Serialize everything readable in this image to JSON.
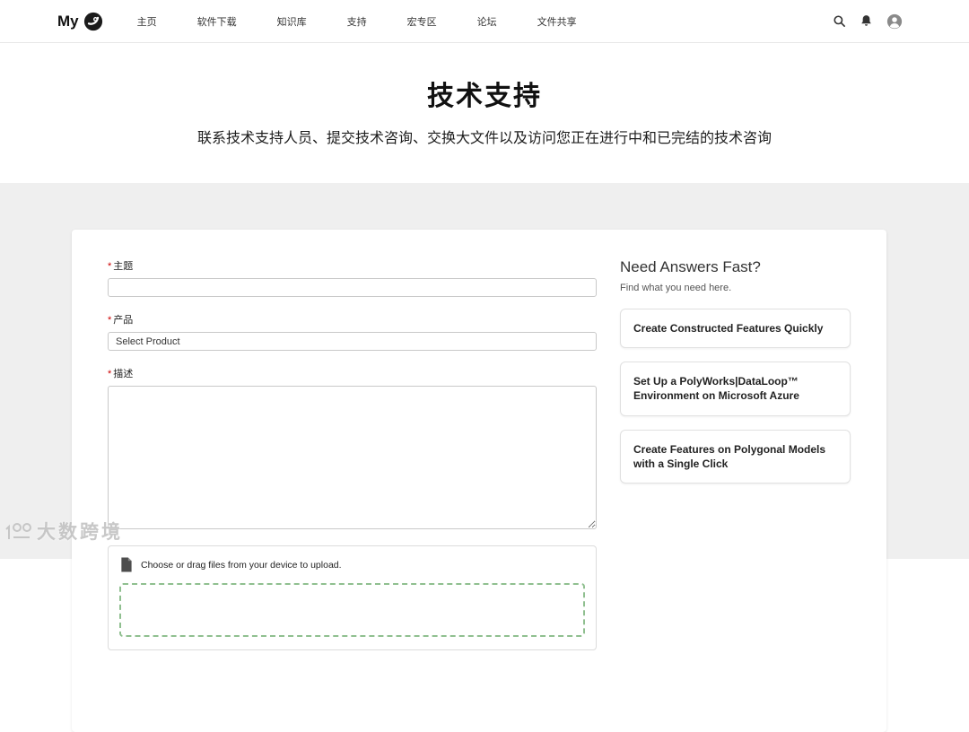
{
  "navbar": {
    "brand": "My",
    "items": [
      {
        "label": "主页"
      },
      {
        "label": "软件下载"
      },
      {
        "label": "知识库"
      },
      {
        "label": "支持"
      },
      {
        "label": "宏专区"
      },
      {
        "label": "论坛"
      },
      {
        "label": "文件共享"
      }
    ]
  },
  "hero": {
    "title": "技术支持",
    "subtitle": "联系技术支持人员、提交技术咨询、交换大文件以及访问您正在进行中和已完结的技术咨询"
  },
  "form": {
    "required_marker": "*",
    "subject_label": "主题",
    "subject_value": "",
    "product_label": "产品",
    "product_value": "Select Product",
    "description_label": "描述",
    "description_value": "",
    "upload_text": "Choose or drag files from your device to upload."
  },
  "aside": {
    "title": "Need Answers Fast?",
    "subtitle": "Find what you need here.",
    "cards": [
      {
        "label": "Create Constructed Features Quickly"
      },
      {
        "label": "Set Up a PolyWorks|DataLoop™ Environment on Microsoft Azure"
      },
      {
        "label": "Create Features on Polygonal Models with a Single Click"
      }
    ]
  },
  "watermark": {
    "text": "大数跨境"
  },
  "colors": {
    "required": "#cc0000",
    "dropzone_dashed": "#8fbf8f",
    "page_background": "#efefef"
  }
}
